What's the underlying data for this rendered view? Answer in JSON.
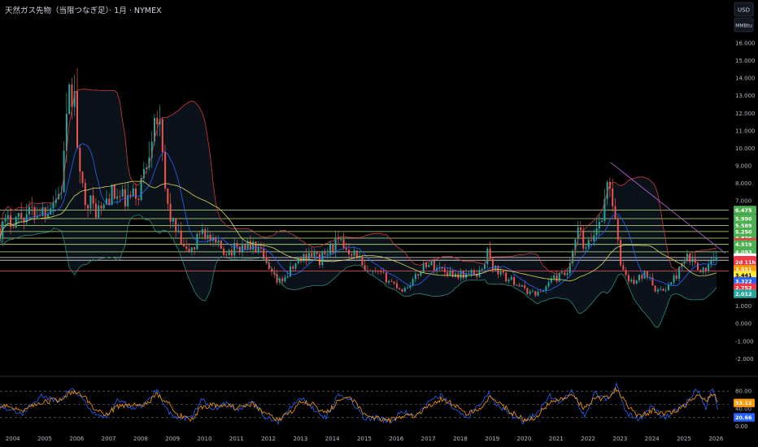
{
  "title": "天然ガス先物（当限つなぎ足）· 1月 · NYMEX",
  "units": {
    "currency": "USD",
    "measure": "MMBtu"
  },
  "colors": {
    "background": "#000000",
    "candle_up": "#26a69a",
    "candle_down": "#ef5350",
    "bb_upper": "#d03a3a",
    "bb_lower": "#2f8a7a",
    "bb_fill": "#0b1219",
    "ma_blue": "#2962ff",
    "ma_yellow": "#d8d35a",
    "hline_green": "#b9e88a",
    "hline_red": "#ef5350",
    "hline_white": "#e8e8e8",
    "trendline": "#b05ad0",
    "osc_blue": "#2962ff",
    "osc_orange": "#ff9800"
  },
  "chart_data": [
    {
      "type": "candlestick",
      "title": "天然ガス先物（当限つなぎ足）· 1月 · NYMEX",
      "y_unit": "USD/MMBtu",
      "y_ticks": [
        "16.000",
        "15.000",
        "14.000",
        "13.000",
        "12.000",
        "11.000",
        "10.000",
        "9.000",
        "8.000",
        "7.000",
        "6.000",
        "5.000",
        "4.000",
        "3.000",
        "2.000",
        "1.000",
        "0.000",
        "-1.000",
        "-2.000"
      ],
      "x_ticks": [
        "2004",
        "2005",
        "2006",
        "2007",
        "2008",
        "2009",
        "2010",
        "2011",
        "2012",
        "2013",
        "2014",
        "2015",
        "2016",
        "2017",
        "2018",
        "2019",
        "2020",
        "2021",
        "2022",
        "2023",
        "2024",
        "2025",
        "2026"
      ],
      "ylim": [
        -2.4,
        16.6
      ],
      "xlim": [
        2003.6,
        2026.4
      ],
      "monthly_close_anchors": {
        "t": [
          2003.6,
          2004.0,
          2004.5,
          2005.0,
          2005.5,
          2005.75,
          2005.9,
          2006.1,
          2006.5,
          2006.8,
          2007.0,
          2007.5,
          2007.9,
          2008.2,
          2008.45,
          2008.6,
          2008.8,
          2009.0,
          2009.4,
          2009.7,
          2009.9,
          2010.2,
          2010.6,
          2010.9,
          2011.3,
          2011.7,
          2012.0,
          2012.3,
          2012.6,
          2012.9,
          2013.3,
          2013.6,
          2014.1,
          2014.4,
          2014.8,
          2015.0,
          2015.5,
          2015.9,
          2016.2,
          2016.6,
          2016.9,
          2017.3,
          2017.7,
          2017.9,
          2018.2,
          2018.6,
          2018.85,
          2019.0,
          2019.4,
          2019.8,
          2020.0,
          2020.4,
          2020.6,
          2020.8,
          2021.0,
          2021.4,
          2021.7,
          2021.9,
          2022.0,
          2022.3,
          2022.5,
          2022.65,
          2022.8,
          2023.0,
          2023.3,
          2023.6,
          2023.9,
          2024.1,
          2024.25,
          2024.6,
          2024.9,
          2025.1,
          2025.4,
          2025.6,
          2025.8,
          2026.0
        ],
        "v": [
          5.4,
          6.0,
          6.3,
          6.5,
          7.5,
          12.5,
          13.6,
          8.0,
          6.6,
          6.4,
          7.4,
          7.0,
          7.3,
          9.3,
          12.6,
          10.8,
          7.0,
          5.7,
          4.0,
          4.4,
          5.6,
          4.6,
          4.2,
          4.2,
          4.5,
          4.2,
          3.0,
          2.3,
          2.8,
          3.5,
          4.1,
          3.6,
          4.6,
          4.4,
          3.9,
          2.9,
          2.8,
          2.3,
          1.9,
          2.6,
          3.5,
          3.2,
          2.9,
          2.8,
          2.8,
          2.9,
          4.0,
          3.3,
          2.6,
          2.3,
          1.9,
          1.7,
          1.9,
          2.5,
          2.6,
          2.9,
          5.5,
          4.0,
          4.4,
          5.6,
          6.6,
          8.6,
          6.4,
          3.5,
          2.3,
          2.6,
          2.9,
          2.0,
          1.8,
          2.3,
          3.2,
          3.7,
          3.4,
          3.0,
          3.3,
          3.6
        ]
      },
      "price_badges": [
        {
          "label": "6.475",
          "value": 6.475,
          "color": "#4caf50"
        },
        {
          "label": "5.990",
          "value": 5.99,
          "color": "#4caf50"
        },
        {
          "label": "5.589",
          "value": 5.589,
          "color": "#4caf50"
        },
        {
          "label": "5.250",
          "value": 5.25,
          "color": "#4caf50"
        },
        {
          "label": "4.876",
          "value": 4.876,
          "color": "#4caf50"
        },
        {
          "label": "4.633",
          "value": 4.633,
          "color": "#f23645"
        },
        {
          "label": "4.519",
          "value": 4.519,
          "color": "#4caf50"
        },
        {
          "label": "4.093",
          "value": 4.093,
          "color": "#4caf50"
        },
        {
          "label": "3.769",
          "value": 3.769,
          "color": "#ffffff"
        },
        {
          "label": "3.617",
          "value": 3.617,
          "color": "#f23645"
        },
        {
          "label": "2d 11h",
          "value": 3.5,
          "color": "#f23645"
        },
        {
          "label": "3.551",
          "value": 3.1,
          "color": "#ff9800"
        },
        {
          "label": "3.441",
          "value": 2.76,
          "color": "#ffeb3b"
        },
        {
          "label": "3.322",
          "value": 2.41,
          "color": "#2962ff"
        },
        {
          "label": "2.752",
          "value": 2.05,
          "color": "#f23645"
        },
        {
          "label": "2.012",
          "value": 1.7,
          "color": "#26a69a"
        }
      ],
      "horizontal_levels": [
        {
          "value": 6.475,
          "color": "#b9e88a"
        },
        {
          "value": 5.99,
          "color": "#b9e88a"
        },
        {
          "value": 5.589,
          "color": "#b9e88a"
        },
        {
          "value": 5.25,
          "color": "#b9e88a"
        },
        {
          "value": 4.876,
          "color": "#b9e88a"
        },
        {
          "value": 4.519,
          "color": "#b9e88a"
        },
        {
          "value": 4.093,
          "color": "#b9e88a"
        },
        {
          "value": 3.769,
          "color": "#e8e8e8"
        },
        {
          "value": 3.617,
          "color": "#e8e8e8"
        },
        {
          "value": 3.0,
          "color": "#ef5350"
        }
      ],
      "trendline": {
        "t1": 2022.7,
        "v1": 9.2,
        "t2": 2026.3,
        "v2": 4.0
      }
    },
    {
      "type": "line",
      "y_ticks": [
        "80.00",
        "40.00",
        "20.00",
        "0.00"
      ],
      "ylim": [
        -6,
        106
      ],
      "dashed_levels": [
        80,
        50,
        20
      ],
      "badges": [
        {
          "label": "53.12",
          "value": 53.12,
          "color": "#ff9800"
        },
        {
          "label": "20.66",
          "value": 20.66,
          "color": "#2962ff"
        }
      ],
      "series": [
        {
          "color": "#2962ff",
          "t": [
            2003.6,
            2004.3,
            2004.9,
            2005.4,
            2005.8,
            2006.1,
            2006.5,
            2006.9,
            2007.3,
            2007.8,
            2008.2,
            2008.5,
            2008.9,
            2009.2,
            2009.6,
            2009.9,
            2010.3,
            2010.7,
            2011.0,
            2011.5,
            2011.9,
            2012.3,
            2012.7,
            2013.0,
            2013.4,
            2013.8,
            2014.2,
            2014.6,
            2015.0,
            2015.4,
            2015.8,
            2016.2,
            2016.6,
            2017.0,
            2017.4,
            2017.8,
            2018.2,
            2018.6,
            2018.9,
            2019.2,
            2019.6,
            2020.0,
            2020.4,
            2020.8,
            2021.1,
            2021.5,
            2021.9,
            2022.2,
            2022.6,
            2022.9,
            2023.2,
            2023.6,
            2024.0,
            2024.4,
            2024.8,
            2025.1,
            2025.4,
            2025.7,
            2025.9,
            2026.1
          ],
          "v": [
            45,
            30,
            70,
            55,
            85,
            70,
            30,
            20,
            60,
            40,
            55,
            85,
            30,
            15,
            20,
            60,
            40,
            55,
            35,
            60,
            20,
            10,
            45,
            65,
            40,
            20,
            75,
            60,
            15,
            20,
            10,
            35,
            20,
            55,
            70,
            40,
            20,
            50,
            75,
            45,
            25,
            10,
            30,
            70,
            55,
            80,
            20,
            75,
            60,
            95,
            30,
            15,
            45,
            20,
            40,
            55,
            85,
            40,
            90,
            20
          ]
        },
        {
          "color": "#ff9800",
          "t": [
            2003.6,
            2004.3,
            2004.9,
            2005.4,
            2005.8,
            2006.1,
            2006.5,
            2006.9,
            2007.3,
            2007.8,
            2008.2,
            2008.5,
            2008.9,
            2009.2,
            2009.6,
            2009.9,
            2010.3,
            2010.7,
            2011.0,
            2011.5,
            2011.9,
            2012.3,
            2012.7,
            2013.0,
            2013.4,
            2013.8,
            2014.2,
            2014.6,
            2015.0,
            2015.4,
            2015.8,
            2016.2,
            2016.6,
            2017.0,
            2017.4,
            2017.8,
            2018.2,
            2018.6,
            2018.9,
            2019.2,
            2019.6,
            2020.0,
            2020.4,
            2020.8,
            2021.1,
            2021.5,
            2021.9,
            2022.2,
            2022.6,
            2022.9,
            2023.2,
            2023.6,
            2024.0,
            2024.4,
            2024.8,
            2025.1,
            2025.4,
            2025.7,
            2025.9,
            2026.1
          ],
          "v": [
            50,
            38,
            55,
            60,
            75,
            78,
            45,
            28,
            45,
            50,
            48,
            75,
            50,
            25,
            15,
            45,
            48,
            50,
            42,
            52,
            30,
            15,
            32,
            55,
            50,
            28,
            60,
            65,
            30,
            18,
            14,
            25,
            24,
            45,
            62,
            50,
            28,
            40,
            65,
            55,
            32,
            15,
            22,
            55,
            60,
            72,
            40,
            62,
            66,
            85,
            50,
            22,
            35,
            28,
            35,
            50,
            72,
            55,
            75,
            53
          ]
        }
      ]
    }
  ]
}
